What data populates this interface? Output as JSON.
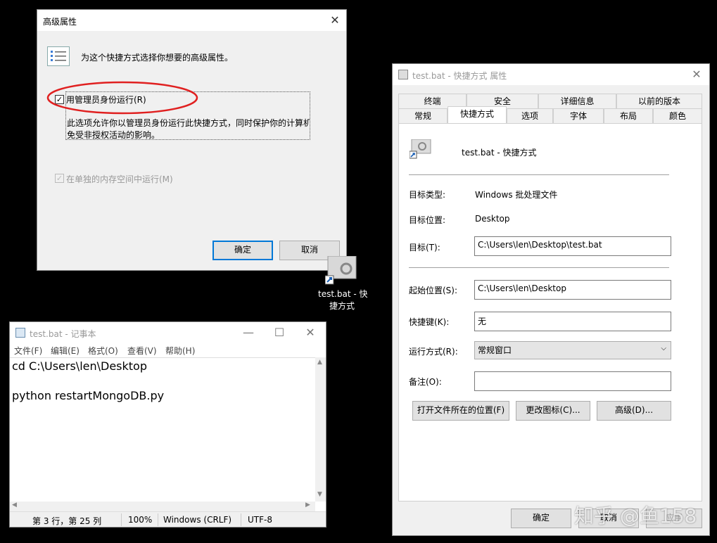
{
  "advanced_dialog": {
    "title": "高级属性",
    "description": "为这个快捷方式选择你想要的高级属性。",
    "run_as_admin_label": "用管理员身份运行(R)",
    "run_as_admin_checked": true,
    "run_as_admin_help_1": "此选项允许你以管理员身份运行此快捷方式，同时保护你的计算机",
    "run_as_admin_help_2": "免受非授权活动的影响。",
    "separate_memory_label": "在单独的内存空间中运行(M)",
    "ok_label": "确定",
    "cancel_label": "取消"
  },
  "desktop_icon": {
    "label_line1": "test.bat - 快",
    "label_line2": "捷方式"
  },
  "notepad": {
    "title": "test.bat - 记事本",
    "menu": [
      "文件(F)",
      "编辑(E)",
      "格式(O)",
      "查看(V)",
      "帮助(H)"
    ],
    "lines": [
      "cd C:\\Users\\len\\Desktop",
      "",
      "python restartMongoDB.py"
    ],
    "status": {
      "position": "第 3 行，第 25 列",
      "zoom": "100%",
      "line_ending": "Windows (CRLF)",
      "encoding": "UTF-8"
    }
  },
  "properties": {
    "title": "test.bat - 快捷方式 属性",
    "tabs_row1": [
      "终端",
      "安全",
      "详细信息",
      "以前的版本"
    ],
    "tabs_row2": [
      "常规",
      "快捷方式",
      "选项",
      "字体",
      "布局",
      "颜色"
    ],
    "active_tab": "快捷方式",
    "shortcut_name": "test.bat - 快捷方式",
    "target_type_label": "目标类型:",
    "target_type_value": "Windows 批处理文件",
    "target_location_label": "目标位置:",
    "target_location_value": "Desktop",
    "target_label": "目标(T):",
    "target_value": "C:\\Users\\len\\Desktop\\test.bat",
    "start_in_label": "起始位置(S):",
    "start_in_value": "C:\\Users\\len\\Desktop",
    "hotkey_label": "快捷键(K):",
    "hotkey_value": "无",
    "run_label": "运行方式(R):",
    "run_value": "常规窗口",
    "comment_label": "备注(O):",
    "comment_value": "",
    "open_location_label": "打开文件所在的位置(F)",
    "change_icon_label": "更改图标(C)...",
    "advanced_label": "高级(D)...",
    "ok_label": "确定",
    "cancel_label": "取消",
    "apply_label": "应用"
  },
  "watermark": "知乎 @鱼158",
  "colors": {
    "annotation_red": "#e02020",
    "accent_blue": "#0078d7"
  }
}
